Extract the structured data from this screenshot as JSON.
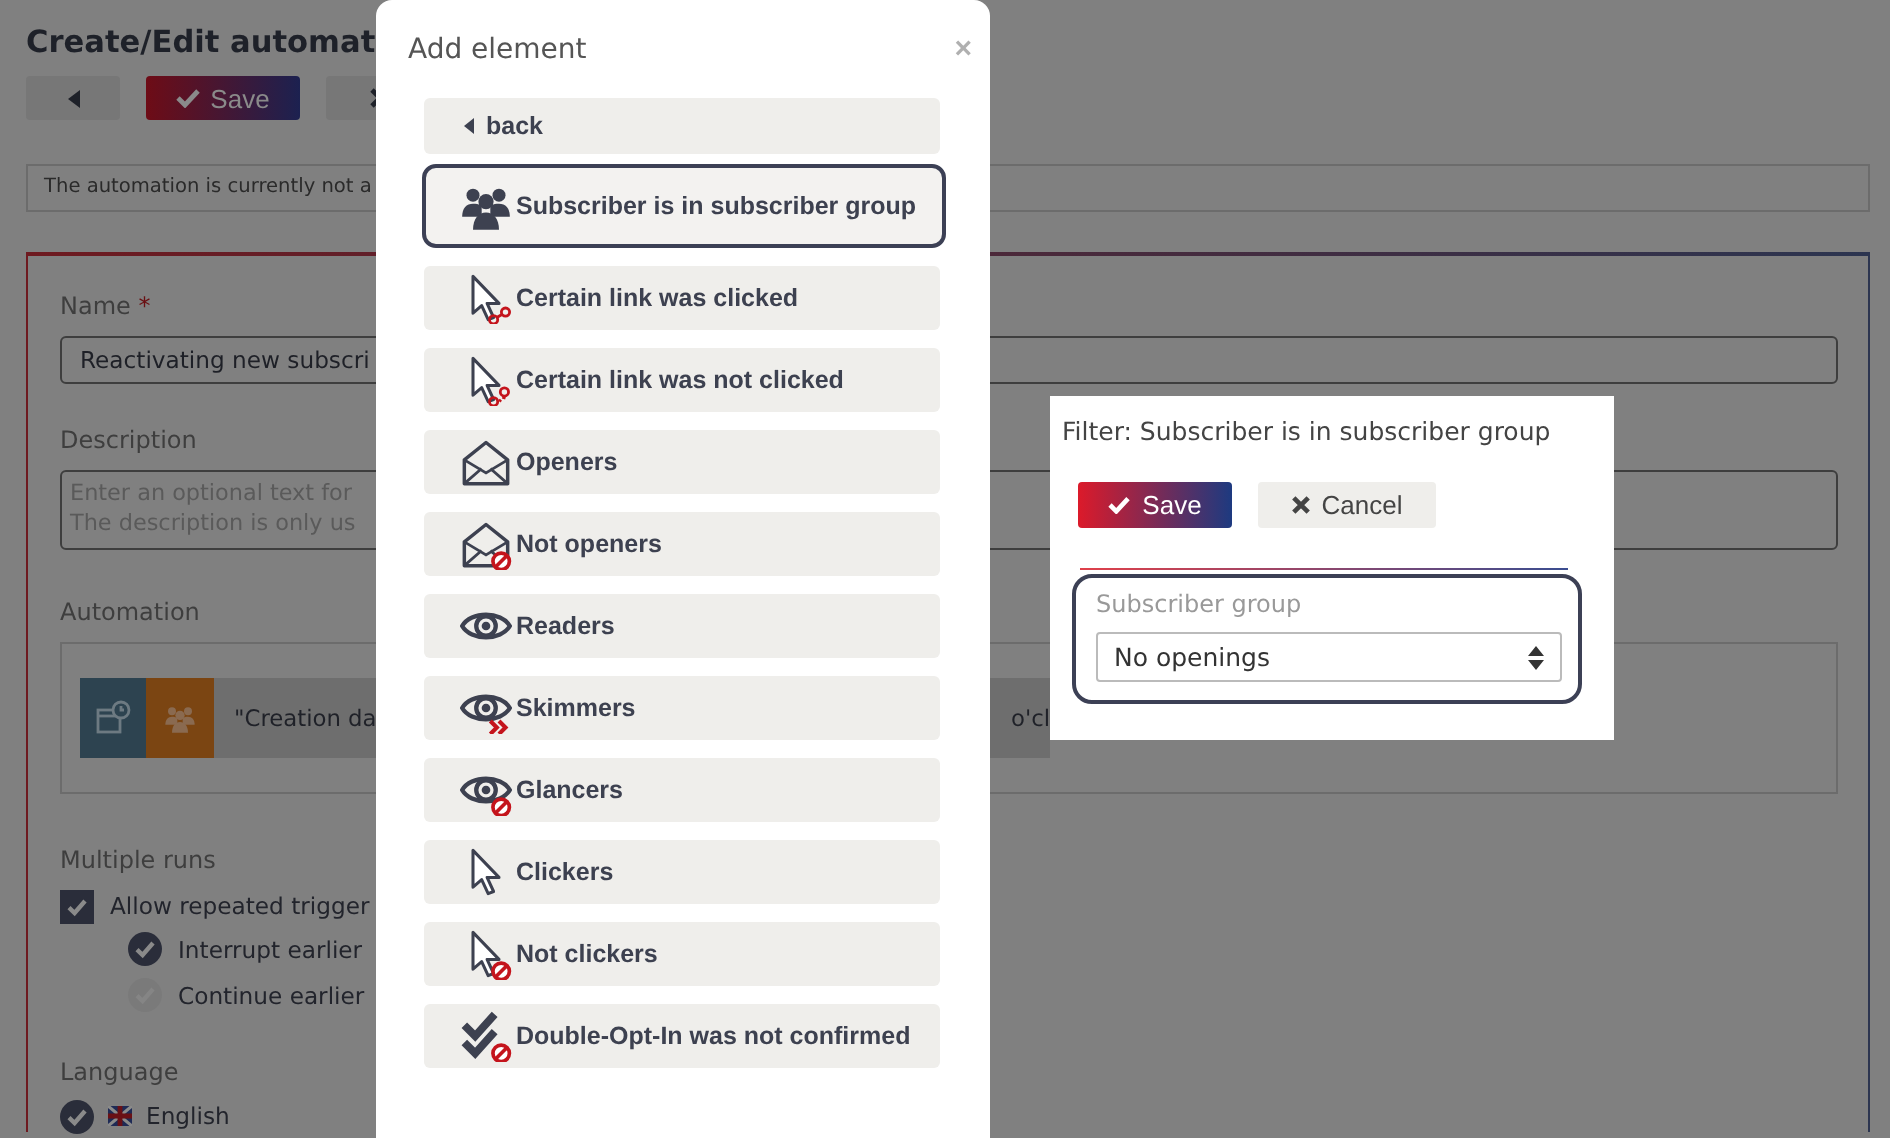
{
  "background": {
    "title": "Create/Edit automat",
    "toolbar": {
      "save": "Save"
    },
    "notice": "The automation is currently not a",
    "name": {
      "label": "Name",
      "required_mark": "*",
      "value": "Reactivating new subscri"
    },
    "description": {
      "label": "Description",
      "placeholder": "Enter an optional text for\nThe description is only us"
    },
    "automation": {
      "label": "Automation",
      "text": "\"Creation da",
      "text_end": "o'cl"
    },
    "multiple_runs": {
      "label": "Multiple runs",
      "checkbox": {
        "label": "Allow repeated trigger",
        "checked": true
      },
      "options": [
        {
          "label": "Interrupt earlier",
          "selected": true
        },
        {
          "label": "Continue earlier",
          "selected": false
        }
      ]
    },
    "language": {
      "label": "Language",
      "options": [
        {
          "label": "English",
          "selected": true
        }
      ]
    }
  },
  "add_element": {
    "title": "Add element",
    "close": "×",
    "back": "back",
    "items": [
      {
        "label": "Subscriber is in subscriber group",
        "kind": "group",
        "selected": true
      },
      {
        "label": "Certain link was clicked",
        "kind": "clicked",
        "selected": false
      },
      {
        "label": "Certain link was not clicked",
        "kind": "unclicked",
        "selected": false
      },
      {
        "label": "Openers",
        "kind": "opener",
        "selected": false
      },
      {
        "label": "Not openers",
        "kind": "nonopener",
        "selected": false
      },
      {
        "label": "Readers",
        "kind": "reader",
        "selected": false
      },
      {
        "label": "Skimmers",
        "kind": "skimmer",
        "selected": false
      },
      {
        "label": "Glancers",
        "kind": "glancer",
        "selected": false
      },
      {
        "label": "Clickers",
        "kind": "clicker",
        "selected": false
      },
      {
        "label": "Not clickers",
        "kind": "nonclicker",
        "selected": false
      },
      {
        "label": "Double-Opt-In was not confirmed",
        "kind": "unconfirmed",
        "selected": false
      }
    ]
  },
  "filter": {
    "title": "Filter: Subscriber is in subscriber group",
    "save": "Save",
    "cancel": "Cancel",
    "field": {
      "label": "Subscriber group",
      "value": "No openings"
    }
  }
}
